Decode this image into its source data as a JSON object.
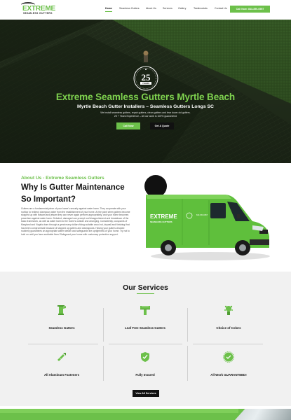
{
  "header": {
    "logo_main": "EXTREME",
    "logo_sub": "SEAMLESS GUTTERS",
    "nav": [
      "Home",
      "Seamless Gutters",
      "About Us",
      "Services",
      "Gallery",
      "Testimonials",
      "Contact Us"
    ],
    "call_button": "Call Now: 843-350-6957"
  },
  "hero": {
    "badge_number": "25",
    "badge_label": "YEARS",
    "title": "Extreme Seamless Gutters Myrtle Beach",
    "subtitle": "Myrtle Beach Gutter Installers – Seamless Gutters Longs SC",
    "line1": "We install seamless gutters, repair gutters, clean gutters and tear down old gutters.",
    "line2": "25 + Years Experience – All our work is 100% guaranteed",
    "btn_call": "Call Now",
    "btn_quote": "Get A Quote"
  },
  "about": {
    "kicker": "About Us - Extreme Seamless Gutters",
    "heading_line1": "Why Is Gutter Maintenance",
    "heading_line2": "So Important?",
    "body": "Gutters are a fundamental piece of your home's security against water harm. They cooperate with your rooftop to redirect downpour water from the establishment of your home. At the point when gutters become stopped up with flotsam and jetsam they can never again perform appropriately, and your home becomes powerless against water harm. Deluded, damaged can prompt roof disappointment and breakdown of the basic framework, as well as water harm to the home's outside and arranging. Consistently, occupants of Maryland and Virginia burn through a great many dollars fixing suitable wood rot, drywall and finishing that has been compromised because of stopped up gutters and downspouts. Having your gutters cleaned routinely guarantees an appropriate water stream and safeguards the uprightness of your home. Try not to hold on until you face avoidable fixes! Safeguard your home with customary protection support."
  },
  "services": {
    "title": "Our Services",
    "items": [
      {
        "label": "Seamless Gutters",
        "icon": "gutter-downspout-icon"
      },
      {
        "label": "Leaf Free Seamless Gutters",
        "icon": "gutter-guard-icon"
      },
      {
        "label": "Choice of Colors",
        "icon": "paint-roller-icon"
      },
      {
        "label": "All Aluminum Fasteners",
        "icon": "fastener-bolt-icon"
      },
      {
        "label": "Fully Insured",
        "icon": "shield-check-icon"
      },
      {
        "label": "All Work GUARANTEED!",
        "icon": "guarantee-badge-icon"
      }
    ],
    "button": "View All Services"
  },
  "colors": {
    "accent": "#6cc04a",
    "dark": "#111111"
  }
}
